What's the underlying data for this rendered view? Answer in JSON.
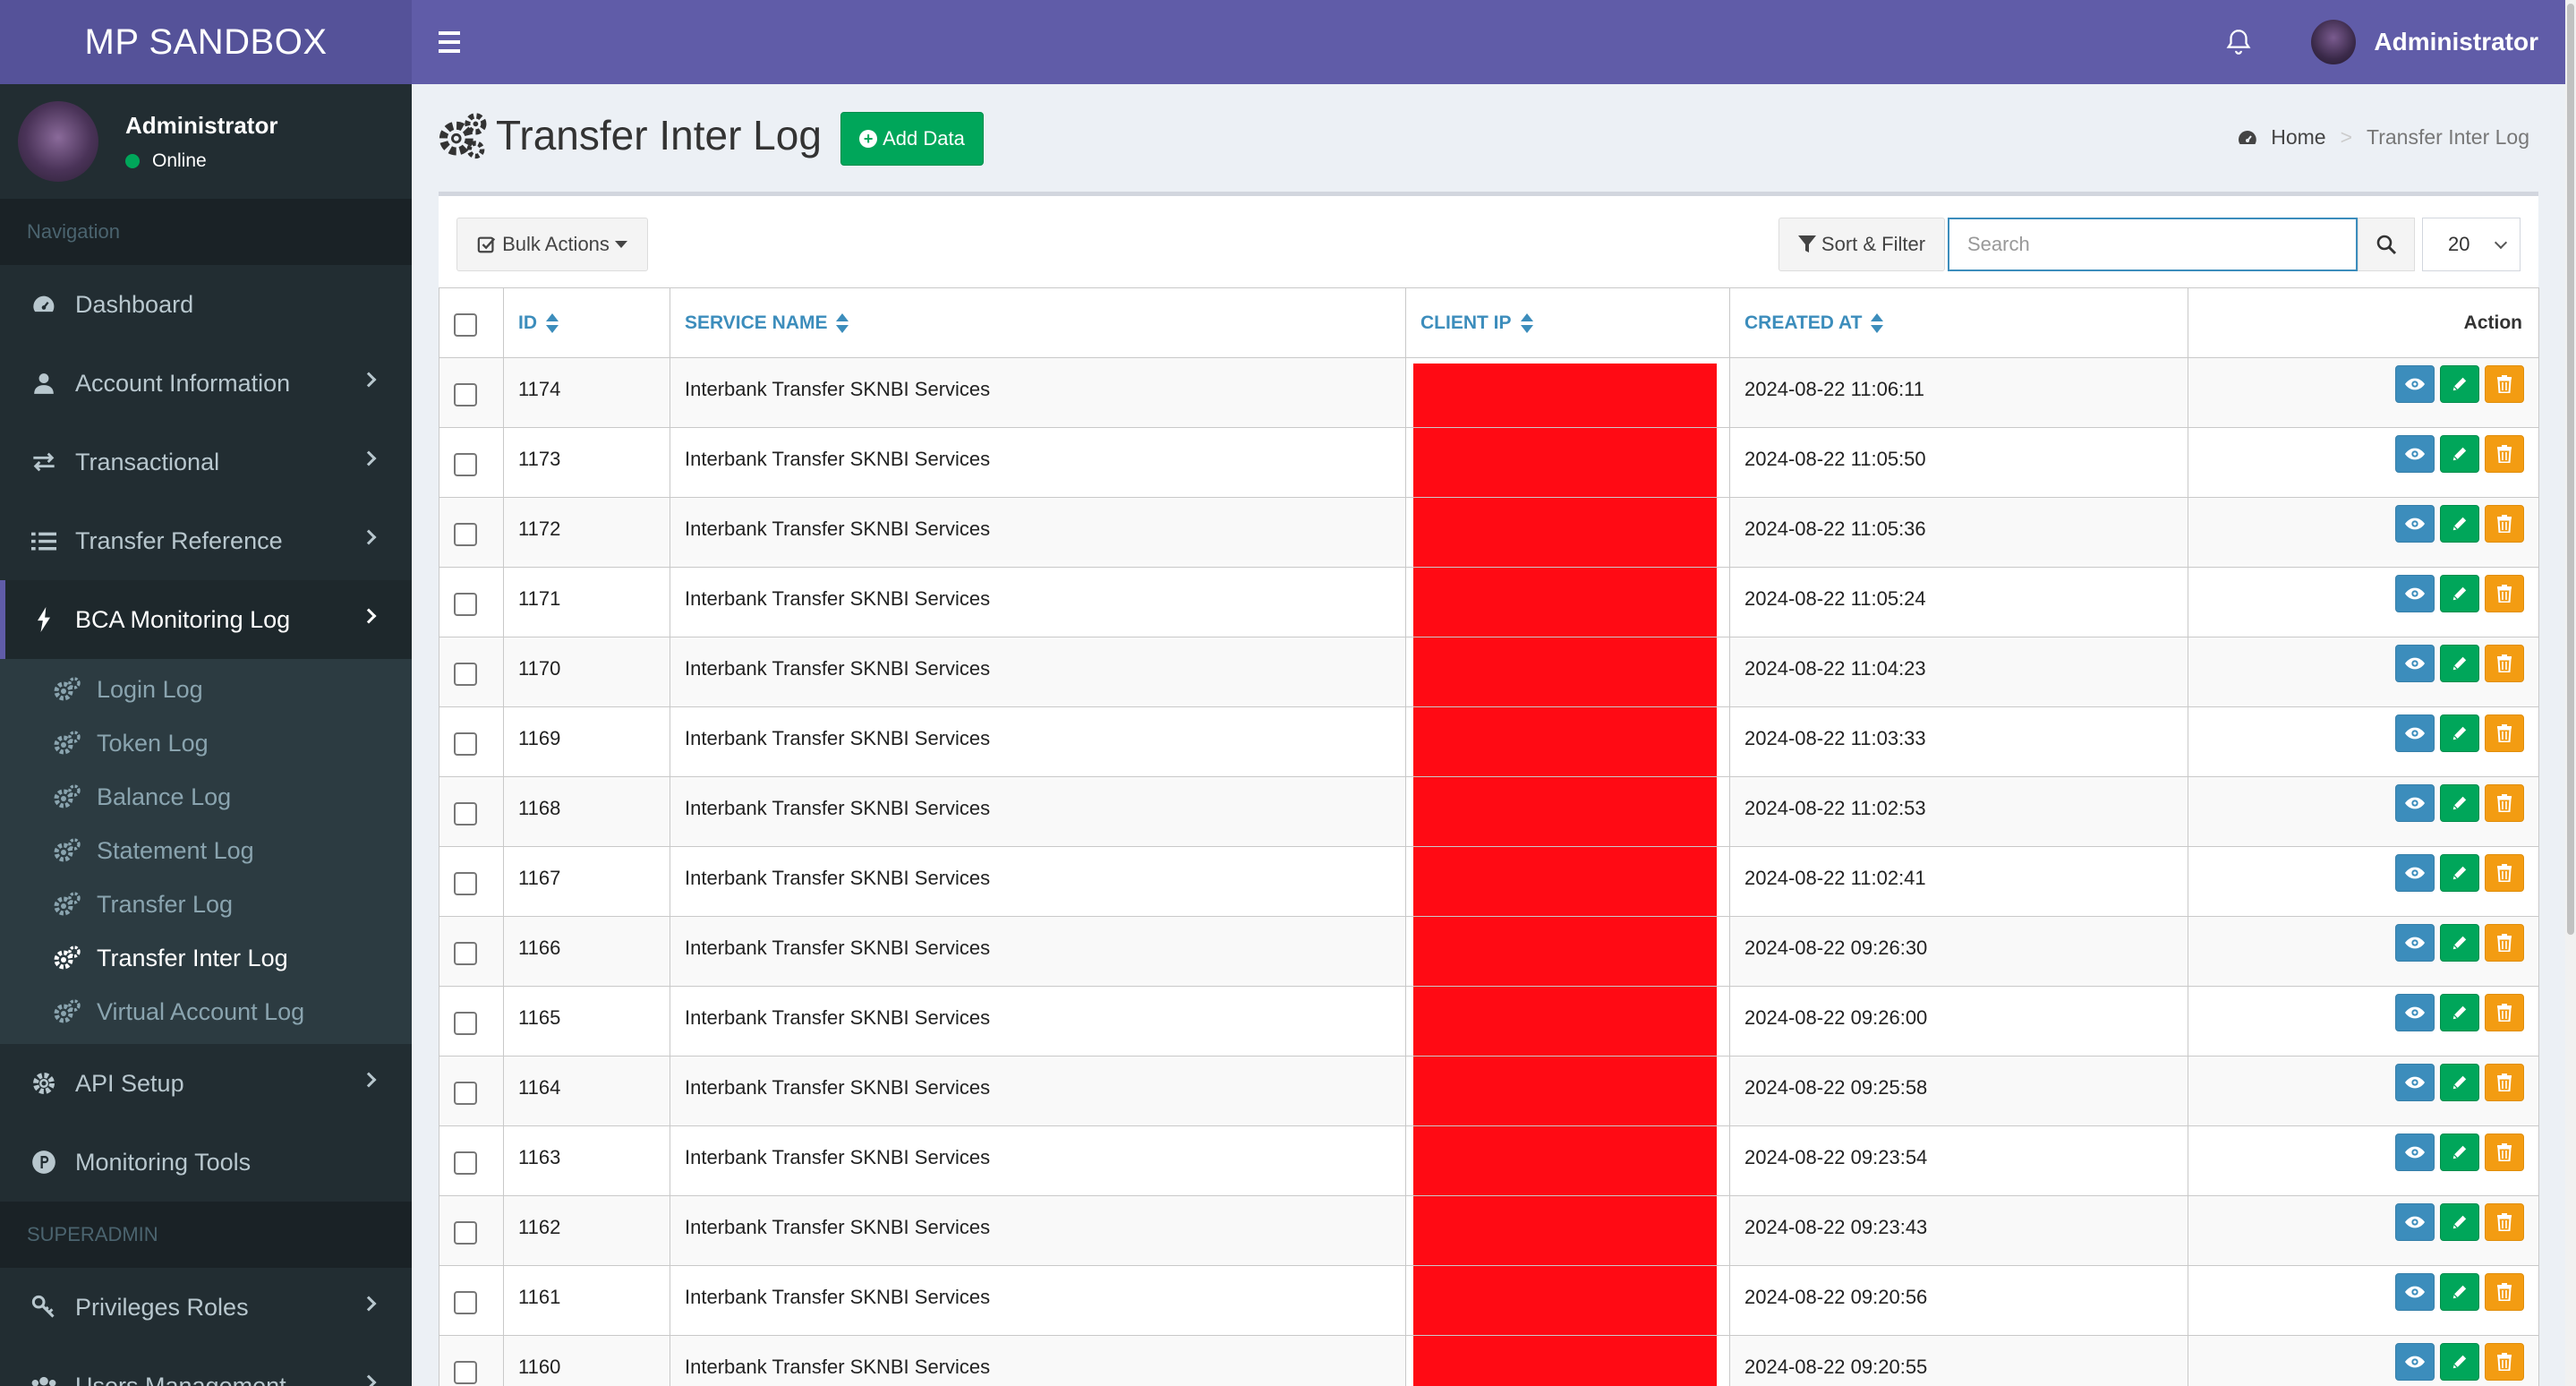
{
  "app": {
    "title": "MP SANDBOX"
  },
  "topbar": {
    "user_name": "Administrator"
  },
  "sidebar": {
    "user_name": "Administrator",
    "user_status": "Online",
    "nav_header": "Navigation",
    "items": [
      {
        "label": "Dashboard",
        "icon": "dashboard-icon"
      },
      {
        "label": "Account Information",
        "icon": "user-icon"
      },
      {
        "label": "Transactional",
        "icon": "exchange-icon"
      },
      {
        "label": "Transfer Reference",
        "icon": "list-icon"
      },
      {
        "label": "BCA Monitoring Log",
        "icon": "bolt-icon"
      }
    ],
    "submenu": [
      {
        "label": "Login Log"
      },
      {
        "label": "Token Log"
      },
      {
        "label": "Balance Log"
      },
      {
        "label": "Statement Log"
      },
      {
        "label": "Transfer Log"
      },
      {
        "label": "Transfer Inter Log"
      },
      {
        "label": "Virtual Account Log"
      }
    ],
    "items2": [
      {
        "label": "API Setup",
        "icon": "gear-icon"
      },
      {
        "label": "Monitoring Tools",
        "icon": "product-hunt-icon"
      }
    ],
    "admin_header": "SUPERADMIN",
    "items3": [
      {
        "label": "Privileges Roles",
        "icon": "key-icon"
      },
      {
        "label": "Users Management",
        "icon": "users-icon"
      }
    ]
  },
  "page": {
    "title": "Transfer Inter Log",
    "add_button": "Add Data",
    "breadcrumb": {
      "home": "Home",
      "separator": ">",
      "current": "Transfer Inter Log"
    }
  },
  "toolbar": {
    "bulk_actions": "Bulk Actions",
    "sort_filter": "Sort & Filter",
    "search_placeholder": "Search",
    "page_size": "20"
  },
  "table": {
    "columns": [
      "ID",
      "SERVICE NAME",
      "CLIENT IP",
      "CREATED AT",
      "Action"
    ],
    "rows": [
      {
        "id": "1174",
        "service": "Interbank Transfer SKNBI Services",
        "created": "2024-08-22 11:06:11"
      },
      {
        "id": "1173",
        "service": "Interbank Transfer SKNBI Services",
        "created": "2024-08-22 11:05:50"
      },
      {
        "id": "1172",
        "service": "Interbank Transfer SKNBI Services",
        "created": "2024-08-22 11:05:36"
      },
      {
        "id": "1171",
        "service": "Interbank Transfer SKNBI Services",
        "created": "2024-08-22 11:05:24"
      },
      {
        "id": "1170",
        "service": "Interbank Transfer SKNBI Services",
        "created": "2024-08-22 11:04:23"
      },
      {
        "id": "1169",
        "service": "Interbank Transfer SKNBI Services",
        "created": "2024-08-22 11:03:33"
      },
      {
        "id": "1168",
        "service": "Interbank Transfer SKNBI Services",
        "created": "2024-08-22 11:02:53"
      },
      {
        "id": "1167",
        "service": "Interbank Transfer SKNBI Services",
        "created": "2024-08-22 11:02:41"
      },
      {
        "id": "1166",
        "service": "Interbank Transfer SKNBI Services",
        "created": "2024-08-22 09:26:30"
      },
      {
        "id": "1165",
        "service": "Interbank Transfer SKNBI Services",
        "created": "2024-08-22 09:26:00"
      },
      {
        "id": "1164",
        "service": "Interbank Transfer SKNBI Services",
        "created": "2024-08-22 09:25:58"
      },
      {
        "id": "1163",
        "service": "Interbank Transfer SKNBI Services",
        "created": "2024-08-22 09:23:54"
      },
      {
        "id": "1162",
        "service": "Interbank Transfer SKNBI Services",
        "created": "2024-08-22 09:23:43"
      },
      {
        "id": "1161",
        "service": "Interbank Transfer SKNBI Services",
        "created": "2024-08-22 09:20:56"
      },
      {
        "id": "1160",
        "service": "Interbank Transfer SKNBI Services",
        "created": "2024-08-22 09:20:55"
      }
    ]
  },
  "colors": {
    "header": "#605ca8",
    "logo_bg": "#555299",
    "sidebar": "#222d32",
    "accent_link": "#3c8dbc",
    "success": "#00a65a",
    "warning": "#f39c12",
    "redaction": "#ff0a14"
  }
}
